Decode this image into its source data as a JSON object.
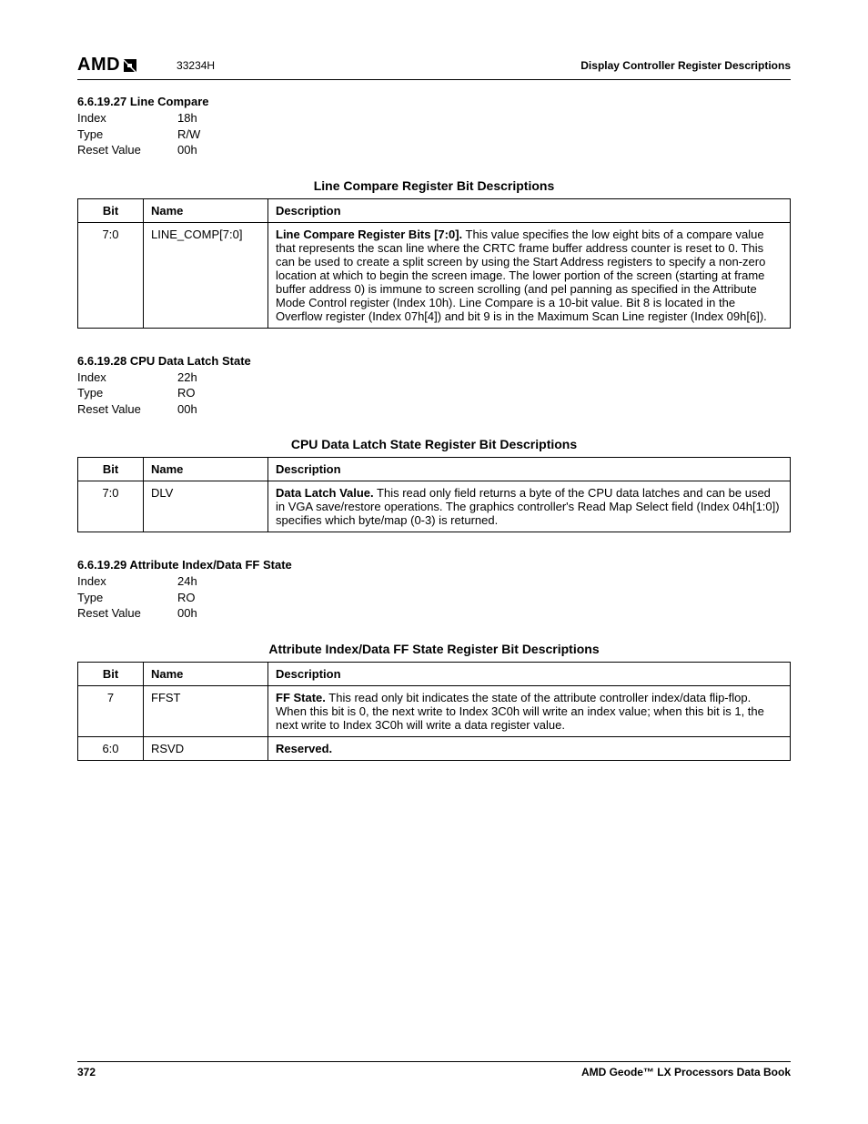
{
  "header": {
    "logo_text": "AMD",
    "doc_code": "33234H",
    "doc_section": "Display Controller Register Descriptions"
  },
  "sections": [
    {
      "heading": "6.6.19.27 Line Compare",
      "meta": {
        "index_label": "Index",
        "index_value": "18h",
        "type_label": "Type",
        "type_value": "R/W",
        "reset_label": "Reset Value",
        "reset_value": "00h"
      },
      "caption": "Line Compare Register Bit Descriptions",
      "columns": {
        "bit": "Bit",
        "name": "Name",
        "desc": "Description"
      },
      "rows": [
        {
          "bit": "7:0",
          "name": "LINE_COMP[7:0]",
          "desc_bold": "Line Compare Register Bits [7:0].",
          "desc_rest": " This value specifies the low eight bits of a compare value that represents the scan line where the CRTC frame buffer address counter is reset to 0. This can be used to create a split screen by using the Start Address registers to specify a non-zero location at which to begin the screen image. The lower portion of the screen (starting at frame buffer address 0) is immune to screen scrolling (and pel panning as specified in the Attribute Mode Control register (Index 10h). Line Compare is a 10-bit value. Bit 8 is located in the Overflow register (Index 07h[4]) and bit 9 is in the Maximum Scan Line register (Index 09h[6])."
        }
      ]
    },
    {
      "heading": "6.6.19.28 CPU Data Latch State",
      "meta": {
        "index_label": "Index",
        "index_value": "22h",
        "type_label": "Type",
        "type_value": "RO",
        "reset_label": "Reset Value",
        "reset_value": "00h"
      },
      "caption": "CPU Data Latch State Register Bit Descriptions",
      "columns": {
        "bit": "Bit",
        "name": "Name",
        "desc": "Description"
      },
      "rows": [
        {
          "bit": "7:0",
          "name": "DLV",
          "desc_bold": "Data Latch Value.",
          "desc_rest": " This read only field returns a byte of the CPU data latches and can be used in VGA save/restore operations. The graphics controller's Read Map Select field (Index 04h[1:0]) specifies which byte/map (0-3) is returned."
        }
      ]
    },
    {
      "heading": "6.6.19.29 Attribute Index/Data FF State",
      "meta": {
        "index_label": "Index",
        "index_value": "24h",
        "type_label": "Type",
        "type_value": "RO",
        "reset_label": "Reset Value",
        "reset_value": "00h"
      },
      "caption": "Attribute Index/Data FF State Register Bit Descriptions",
      "columns": {
        "bit": "Bit",
        "name": "Name",
        "desc": "Description"
      },
      "rows": [
        {
          "bit": "7",
          "name": "FFST",
          "desc_bold": "FF State.",
          "desc_rest": " This read only bit indicates the state of the attribute controller index/data flip-flop. When this bit is 0, the next write to Index 3C0h will write an index value; when this bit is 1, the next write to Index 3C0h will write a data register value."
        },
        {
          "bit": "6:0",
          "name": "RSVD",
          "desc_bold": "Reserved.",
          "desc_rest": ""
        }
      ]
    }
  ],
  "footer": {
    "page_number": "372",
    "book_title": "AMD Geode™ LX Processors Data Book"
  }
}
